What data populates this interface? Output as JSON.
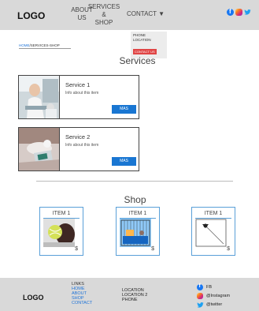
{
  "header": {
    "logo": "LOGO",
    "nav": {
      "about": "ABOUT US",
      "services_l1": "SERVICES",
      "services_l2": "&",
      "services_l3": "SHOP",
      "contact": "CONTACT"
    },
    "dropdown": {
      "item1": "PHONE",
      "item2": "LOCATION",
      "button": "CONTACT US"
    }
  },
  "breadcrumb": {
    "home": "HOME",
    "sep": "/",
    "current": "SERVICES-SHOP"
  },
  "services": {
    "title": "Services",
    "items": [
      {
        "title": "Service 1",
        "info": "Info about this item",
        "button": "MAS"
      },
      {
        "title": "Service 2",
        "info": "Info about this item",
        "button": "MAS"
      }
    ]
  },
  "shop": {
    "title": "Shop",
    "items": [
      {
        "title": "ITEM 1",
        "price": "$"
      },
      {
        "title": "ITEM 1",
        "price": "$"
      },
      {
        "title": "ITEM 1",
        "price": "$"
      }
    ]
  },
  "footer": {
    "logo": "LOGO",
    "links_head": "LINKS",
    "links": [
      "HOME",
      "ABOUT",
      "SHOP",
      "CONTACT"
    ],
    "contact": [
      "LOCATION",
      "LOCATION 2",
      "PHONE"
    ],
    "social": [
      {
        "label": "FB",
        "icon": "facebook-icon"
      },
      {
        "label": "@Instagram",
        "icon": "instagram-icon"
      },
      {
        "label": "@twitter",
        "icon": "twitter-icon"
      }
    ]
  },
  "colors": {
    "header_bg": "#d9d9d9",
    "accent_blue": "#1976d2",
    "dropdown_button": "#e04545",
    "item_border": "#5aa0d8"
  }
}
